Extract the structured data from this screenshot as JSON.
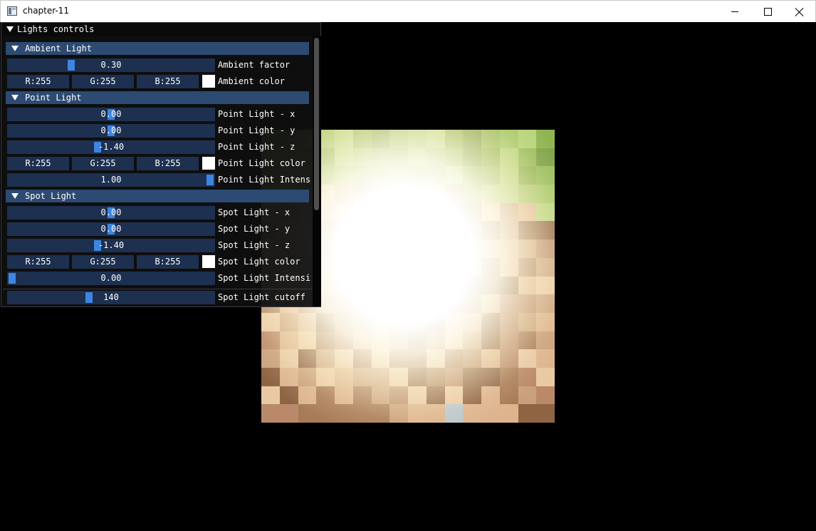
{
  "window": {
    "title": "chapter-11"
  },
  "panel": {
    "title": "Lights controls",
    "ambient": {
      "header": "Ambient Light",
      "factor": {
        "value": "0.30",
        "label": "Ambient factor",
        "fraction": 0.3
      },
      "color": {
        "r": "R:255",
        "g": "G:255",
        "b": "B:255",
        "label": "Ambient color",
        "swatch": "#ffffff"
      }
    },
    "point": {
      "header": "Point Light",
      "x": {
        "value": "0.00",
        "label": "Point Light - x"
      },
      "y": {
        "value": "0.00",
        "label": "Point Light - y"
      },
      "z": {
        "value": "-1.40",
        "label": "Point Light - z"
      },
      "color": {
        "r": "R:255",
        "g": "G:255",
        "b": "B:255",
        "label": "Point Light color",
        "swatch": "#ffffff"
      },
      "intensity": {
        "value": "1.00",
        "label": "Point Light Intensity",
        "fraction": 1.0
      }
    },
    "spot": {
      "header": "Spot Light",
      "x": {
        "value": "0.00",
        "label": "Spot Light - x"
      },
      "y": {
        "value": "0.00",
        "label": "Spot Light - y"
      },
      "z": {
        "value": "-1.40",
        "label": "Spot Light - z"
      },
      "color": {
        "r": "R:255",
        "g": "G:255",
        "b": "B:255",
        "label": "Spot Light color",
        "swatch": "#ffffff"
      },
      "intensity": {
        "value": "0.00",
        "label": "Spot Light Intensity",
        "fraction": 0.0
      },
      "cutoff": {
        "value": "140",
        "label": "Spot Light cutoff"
      }
    }
  },
  "colors": {
    "header_bg": "#2c4a72",
    "frame_bg": "#1d3050",
    "slider_grab": "#3d85e0",
    "panel_bg": "#0f0f0f"
  }
}
